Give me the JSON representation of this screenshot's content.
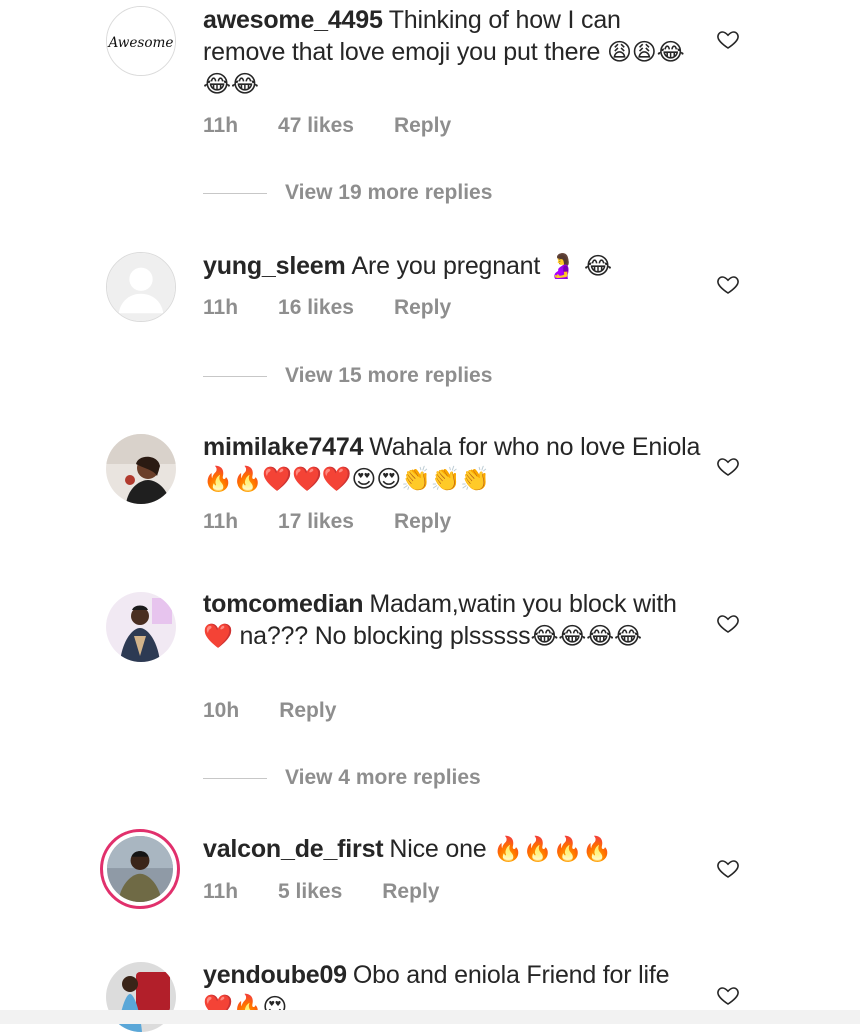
{
  "comments": [
    {
      "username": "awesome_4495",
      "text": "Thinking of how I can remove that love emoji you put there",
      "emojis": "😩😩😂😂😂",
      "time": "11h",
      "likes": "47 likes",
      "reply": "Reply",
      "avatar_text": "Awesome",
      "view_replies": "View 19 more replies"
    },
    {
      "username": "yung_sleem",
      "text": "Are you pregnant",
      "emojis": "🤰 😂",
      "time": "11h",
      "likes": "16 likes",
      "reply": "Reply",
      "view_replies": "View 15 more replies"
    },
    {
      "username": "mimilake7474",
      "text": "Wahala for who no love Eniola",
      "emojis": "🔥🔥❤️❤️❤️😍😍👏👏👏",
      "time": "11h",
      "likes": "17 likes",
      "reply": "Reply"
    },
    {
      "username": "tomcomedian",
      "text": "Madam,watin you block with",
      "emoji_mid": "❤️",
      "text_after": "na??? No blocking plsssss",
      "emojis": "😂😂😂😂",
      "time": "10h",
      "reply": "Reply",
      "view_replies": "View 4 more replies"
    },
    {
      "username": "valcon_de_first",
      "text": "Nice one",
      "emojis": "🔥🔥🔥🔥",
      "time": "11h",
      "likes": "5 likes",
      "reply": "Reply"
    },
    {
      "username": "yendoube09",
      "text": "Obo and eniola Friend for life",
      "emojis": "❤️🔥😍"
    }
  ],
  "icons": {
    "like": "heart-outline-icon"
  },
  "colors": {
    "meta_text": "#8e8e8e",
    "story_ring": "#e1306c"
  }
}
